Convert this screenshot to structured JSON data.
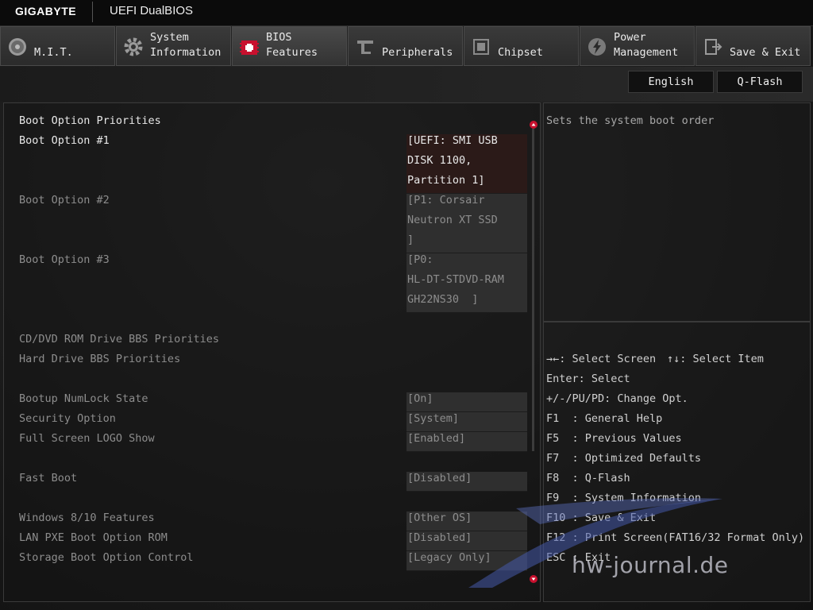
{
  "header": {
    "brand": "GIGABYTE",
    "product": "UEFI DualBIOS"
  },
  "tabs": [
    {
      "label": "M.I.T.",
      "icon": "gauge-icon"
    },
    {
      "label": "System\nInformation",
      "icon": "gear-icon"
    },
    {
      "label": "BIOS\nFeatures",
      "icon": "bios-chip-icon",
      "active": true
    },
    {
      "label": "Peripherals",
      "icon": "peripherals-icon"
    },
    {
      "label": "Chipset",
      "icon": "chipset-icon"
    },
    {
      "label": "Power\nManagement",
      "icon": "power-icon"
    },
    {
      "label": "Save & Exit",
      "icon": "exit-icon"
    }
  ],
  "toolbar": {
    "language": "English",
    "qflash": "Q-Flash"
  },
  "settings": {
    "section_title": "Boot Option Priorities",
    "boot1_label": "Boot Option #1",
    "boot1_value": "[UEFI: SMI USB\nDISK 1100,\nPartition 1]",
    "boot2_label": "Boot Option #2",
    "boot2_value": "[P1: Corsair\nNeutron XT SSD\n]",
    "boot3_label": "Boot Option #3",
    "boot3_value": "[P0:\nHL-DT-STDVD-RAM\nGH22NS30  ]",
    "cddvd_label": "CD/DVD ROM Drive BBS Priorities",
    "hdd_label": "Hard Drive BBS Priorities",
    "numlock_label": "Bootup NumLock State",
    "numlock_value": "[On]",
    "security_label": "Security Option",
    "security_value": "[System]",
    "logo_label": "Full Screen LOGO Show",
    "logo_value": "[Enabled]",
    "fastboot_label": "Fast Boot",
    "fastboot_value": "[Disabled]",
    "win_label": "Windows 8/10 Features",
    "win_value": "[Other OS]",
    "lan_label": "LAN PXE Boot Option ROM",
    "lan_value": "[Disabled]",
    "storage_label": "Storage Boot Option Control",
    "storage_value": "[Legacy Only]"
  },
  "description": "Sets the system boot order",
  "help": {
    "select_screen": "→←: Select Screen",
    "select_item": "↑↓: Select Item",
    "enter": "Enter: Select",
    "change": "+/-/PU/PD: Change Opt.",
    "f1": "F1  : General Help",
    "f5": "F5  : Previous Values",
    "f7": "F7  : Optimized Defaults",
    "f8": "F8  : Q-Flash",
    "f9": "F9  : System Information",
    "f10": "F10 : Save & Exit",
    "f12": "F12 : Print Screen(FAT16/32 Format Only)",
    "esc": "ESC : Exit"
  },
  "watermark": "hw-journal.de",
  "colors": {
    "accent_red": "#c8102e",
    "selected_bg": "#2b1a18"
  }
}
